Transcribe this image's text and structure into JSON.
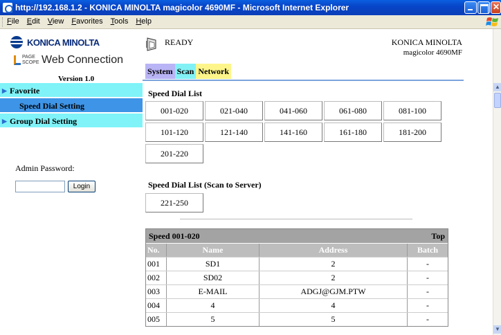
{
  "window": {
    "title": "http://192.168.1.2 - KONICA MINOLTA magicolor 4690MF - Microsoft Internet Explorer"
  },
  "menu": [
    "File",
    "Edit",
    "View",
    "Favorites",
    "Tools",
    "Help"
  ],
  "brand": {
    "logo_text": "KONICA MINOLTA",
    "pagescope_top": "PAGE",
    "pagescope_bottom": "SCOPE",
    "product": "Web Connection",
    "version": "Version 1.0"
  },
  "nav": [
    {
      "label": "Favorite"
    },
    {
      "label": "Speed Dial Setting"
    },
    {
      "label": "Group Dial Setting"
    }
  ],
  "admin": {
    "label": "Admin Password:",
    "password_value": "",
    "login_label": "Login"
  },
  "header": {
    "status": "READY",
    "brand": "KONICA MINOLTA",
    "model": "magicolor 4690MF"
  },
  "tabs": [
    "System",
    "Scan",
    "Network"
  ],
  "speed_dial": {
    "title": "Speed Dial List",
    "ranges": [
      "001-020",
      "021-040",
      "041-060",
      "061-080",
      "081-100",
      "101-120",
      "121-140",
      "141-160",
      "161-180",
      "181-200",
      "201-220"
    ]
  },
  "server_dial": {
    "title": "Speed Dial List (Scan to Server)",
    "ranges": [
      "221-250"
    ]
  },
  "table": {
    "title": "Speed 001-020",
    "top_link": "Top",
    "columns": [
      "No.",
      "Name",
      "Address",
      "Batch"
    ],
    "rows": [
      [
        "001",
        "SD1",
        "2",
        "-"
      ],
      [
        "002",
        "SD02",
        "2",
        "-"
      ],
      [
        "003",
        "E-MAIL",
        "ADGJ@GJM.PTW",
        "-"
      ],
      [
        "004",
        "4",
        "4",
        "-"
      ],
      [
        "005",
        "5",
        "5",
        "-"
      ]
    ]
  },
  "colors": {
    "nav_cyan": "#7ff3f8",
    "nav_active": "#3e94e6",
    "tab_system": "#b9b4f5",
    "tab_scan": "#82f1f5",
    "tab_network": "#fdf58a"
  }
}
